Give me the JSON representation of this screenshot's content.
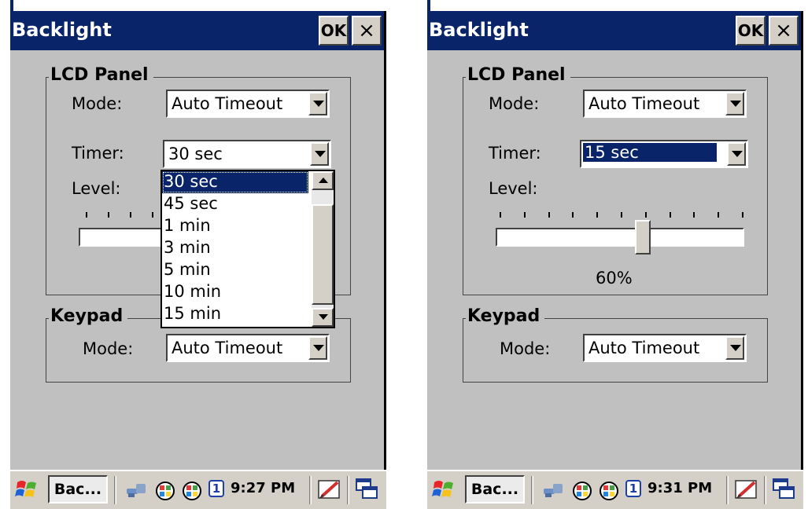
{
  "left_screen": {
    "window_title": "Backlight",
    "ok_label": "OK",
    "close_glyph": "×",
    "lcd_group_label": "LCD Panel",
    "mode_label": "Mode:",
    "mode_value": "Auto Timeout",
    "timer_label": "Timer:",
    "timer_value": "30 sec",
    "level_label": "Level:",
    "timer_options": [
      "30 sec",
      "45 sec",
      "1 min",
      "3 min",
      "5 min",
      "10 min",
      "15 min"
    ],
    "selected_option": "30 sec",
    "keypad_group_label": "Keypad",
    "keypad_mode_label": "Mode:",
    "keypad_mode_value": "Auto Timeout",
    "taskbar": {
      "task_button_label": "Bac...",
      "tray_badge": "1",
      "clock": "9:27 PM"
    }
  },
  "right_screen": {
    "window_title": "Backlight",
    "ok_label": "OK",
    "close_glyph": "×",
    "lcd_group_label": "LCD Panel",
    "mode_label": "Mode:",
    "mode_value": "Auto Timeout",
    "timer_label": "Timer:",
    "timer_value": "15 sec",
    "level_label": "Level:",
    "level_value": 0.6,
    "level_percent_text": "60%",
    "keypad_group_label": "Keypad",
    "keypad_mode_label": "Mode:",
    "keypad_mode_value": "Auto Timeout",
    "taskbar": {
      "task_button_label": "Bac...",
      "tray_badge": "1",
      "clock": "9:31 PM"
    }
  },
  "colors": {
    "title_bar": "#0a246a",
    "dialog_background": "#c0c0c0",
    "selection": "#0a246a"
  },
  "icons": [
    "windows-start-icon",
    "network-icon",
    "color-grid-icon",
    "close-icon",
    "chevron-down-icon",
    "chevron-up-icon",
    "pen-input-icon",
    "window-switch-icon"
  ]
}
